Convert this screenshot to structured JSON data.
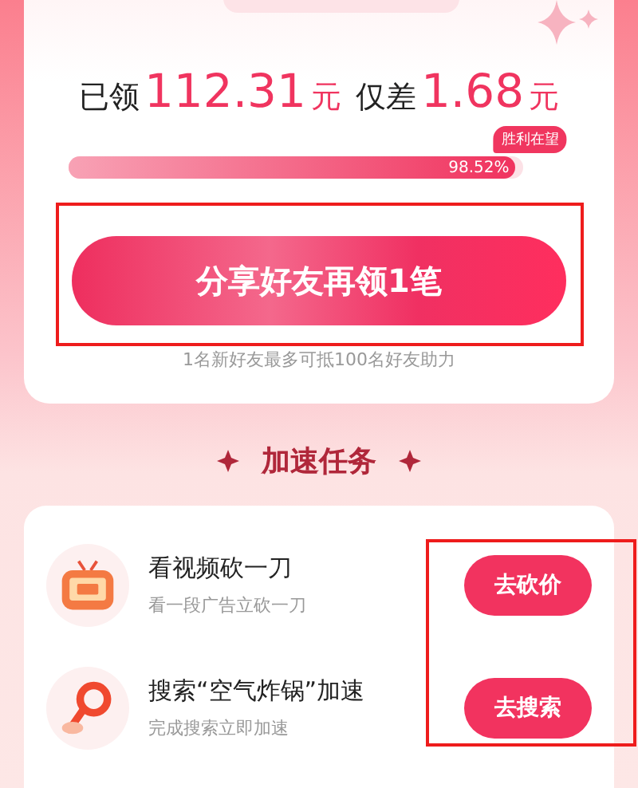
{
  "summary": {
    "received_label": "已领",
    "received_amount": "112.31",
    "received_unit": "元",
    "gap_label": "仅差",
    "gap_amount": "1.68",
    "gap_unit": "元"
  },
  "progress": {
    "badge": "胜利在望",
    "level": 0.9852,
    "reading": "98.52%"
  },
  "share_button": "分享好友再领1笔",
  "note": "1名新好友最多可抵100名好友助力",
  "section_title": "加速任务",
  "tasks": [
    {
      "kind": "video",
      "title": "看视频砍一刀",
      "subtitle": "看一段广告立砍一刀",
      "action": "去砍价"
    },
    {
      "kind": "search",
      "title": "搜索“空气炸锅”加速",
      "subtitle": "完成搜索立即加速",
      "action": "去搜索"
    }
  ]
}
